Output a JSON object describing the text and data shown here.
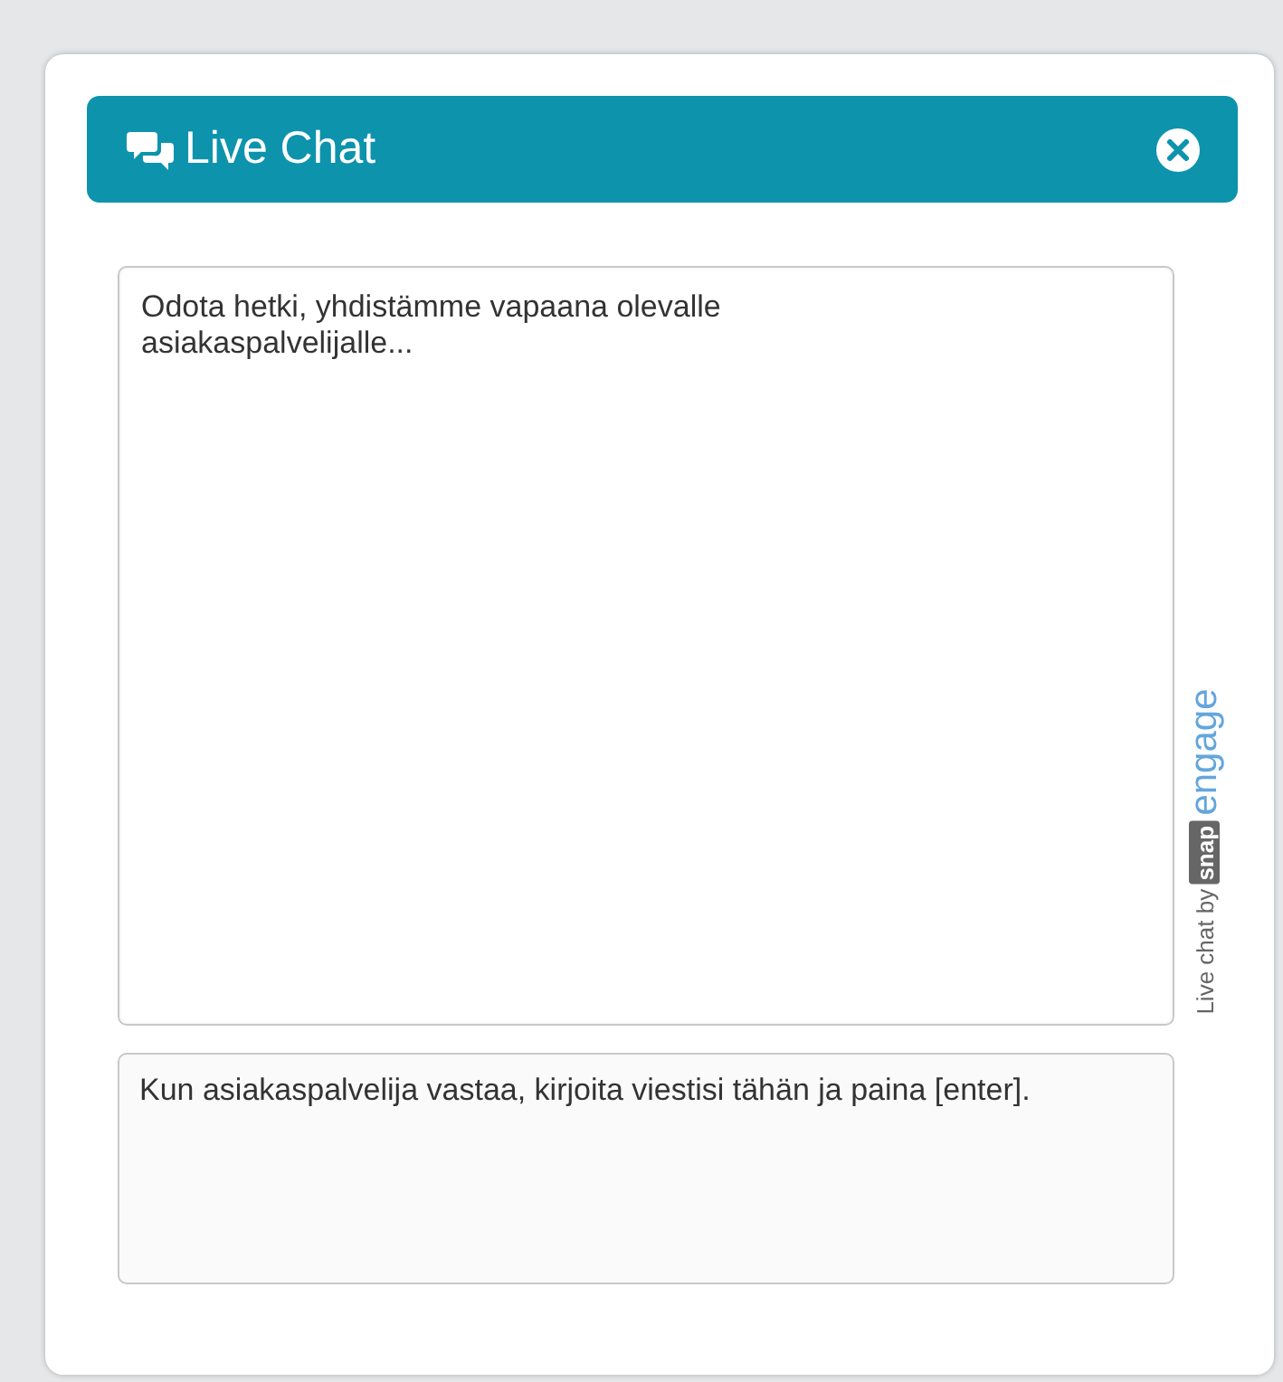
{
  "header": {
    "title": "Live Chat"
  },
  "transcript": {
    "messages": [
      "Odota hetki, yhdistämme vapaana olevalle asiakaspalvelijalle..."
    ]
  },
  "message_input": {
    "placeholder": "Kun asiakaspalvelija vastaa, kirjoita viestisi tähän ja paina [enter]."
  },
  "branding": {
    "prefix": "Live chat by",
    "logo_part_1": "snap",
    "logo_part_2": "engage"
  }
}
